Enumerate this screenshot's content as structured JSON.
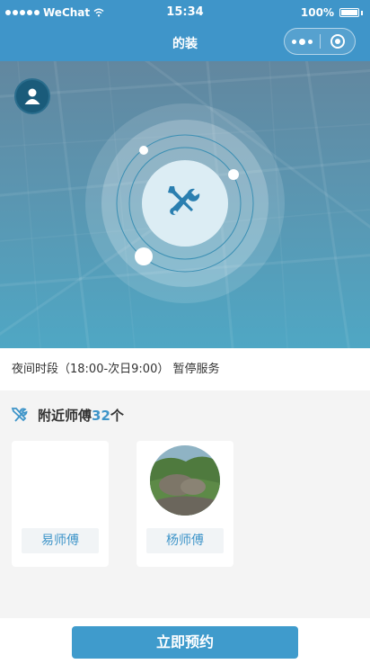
{
  "status_bar": {
    "carrier": "WeChat",
    "time": "15:34",
    "battery": "100%"
  },
  "nav": {
    "title": "的装"
  },
  "icons": {
    "avatar": "user-icon",
    "center": "tools-icon",
    "section": "tools-icon",
    "capsule_more": "more-dots-icon",
    "capsule_close": "target-icon"
  },
  "notice": {
    "text": "夜间时段（18:00-次日9:00） 暂停服务"
  },
  "nearby": {
    "label": "附近师傅",
    "count": "32",
    "unit": "个"
  },
  "masters": [
    {
      "name": "易师傅"
    },
    {
      "name": "杨师傅"
    }
  ],
  "actions": {
    "book": "立即预约"
  },
  "colors": {
    "primary": "#3f95c9",
    "button": "#3f9bcc",
    "icon_dark": "#1a5b7a"
  }
}
